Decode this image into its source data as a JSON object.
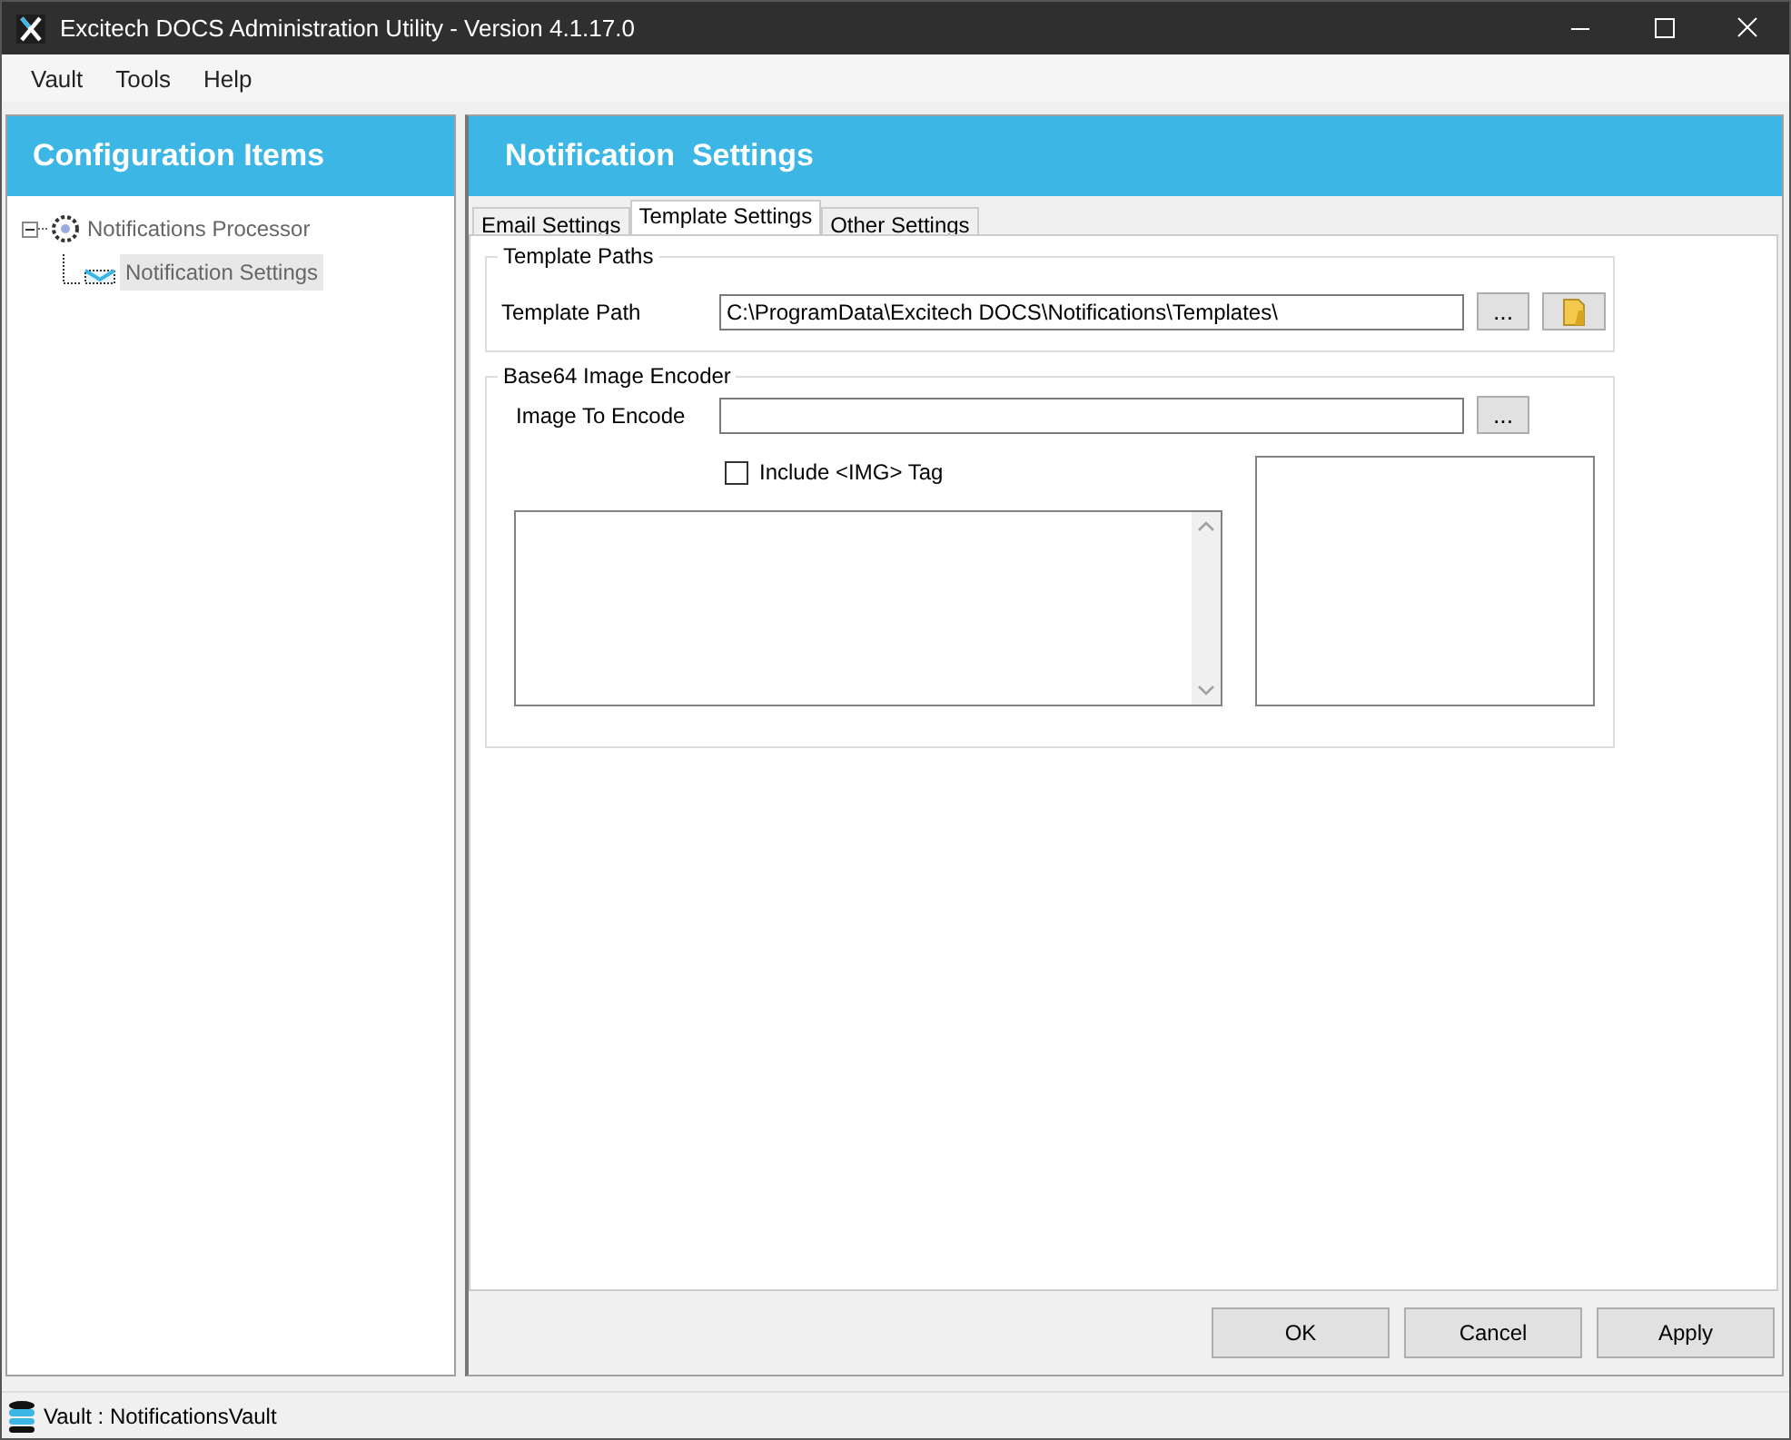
{
  "window": {
    "title": "Excitech DOCS Administration Utility - Version 4.1.17.0"
  },
  "menu": [
    "Vault",
    "Tools",
    "Help"
  ],
  "sidebar": {
    "title": "Configuration Items",
    "tree": [
      {
        "label": "Notifications Processor",
        "expanded": true,
        "selected": false,
        "children": [
          {
            "label": "Notification Settings",
            "selected": true
          }
        ]
      }
    ]
  },
  "panel": {
    "title": "Notification  Settings",
    "tabs": [
      {
        "label": "Email Settings",
        "selected": false
      },
      {
        "label": "Template Settings",
        "selected": true
      },
      {
        "label": "Other Settings",
        "selected": false
      }
    ],
    "template_paths": {
      "title": "Template Paths",
      "label": "Template Path",
      "value": "C:\\ProgramData\\Excitech DOCS\\Notifications\\Templates\\",
      "browse": "..."
    },
    "encoder": {
      "title": "Base64 Image Encoder",
      "label": "Image To Encode",
      "browse": "...",
      "include_tag": {
        "label": "Include <IMG> Tag",
        "checked": false
      }
    }
  },
  "buttons": [
    "OK",
    "Cancel",
    "Apply"
  ],
  "status_bar": "Vault : NotificationsVault"
}
